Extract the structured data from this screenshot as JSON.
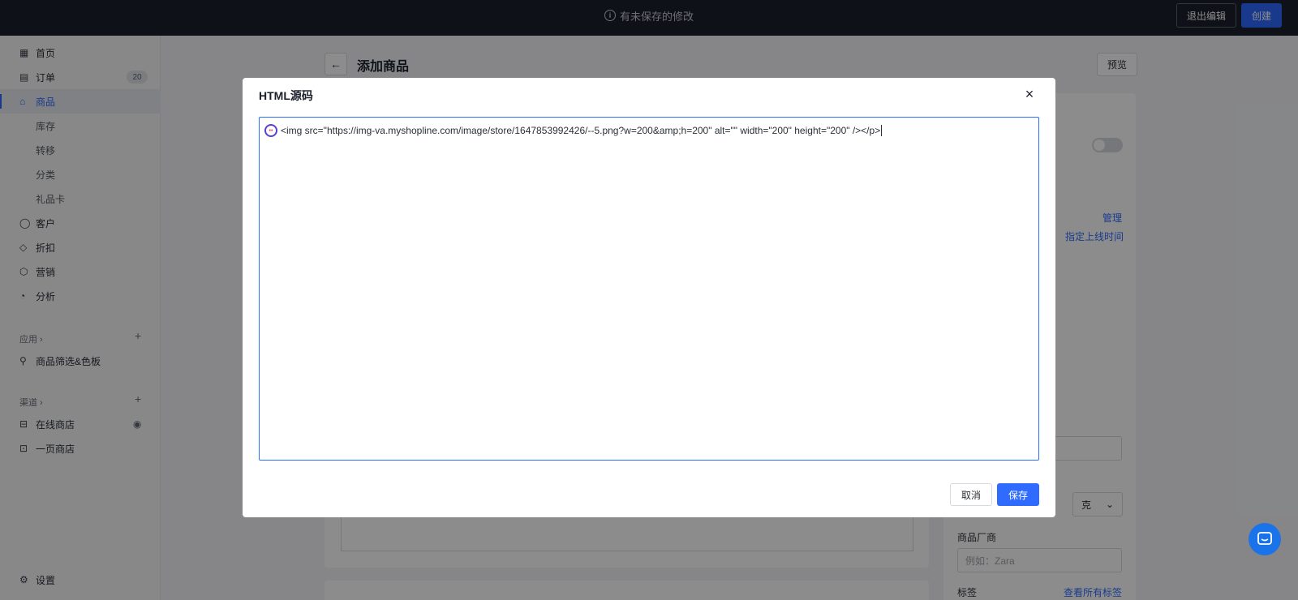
{
  "topbar": {
    "unsaved_text": "有未保存的修改",
    "exit_label": "退出编辑",
    "create_label": "创建"
  },
  "sidebar": {
    "items": [
      {
        "label": "首页",
        "icon": "home-icon"
      },
      {
        "label": "订单",
        "icon": "order-icon",
        "badge": "20"
      },
      {
        "label": "商品",
        "icon": "bag-icon"
      },
      {
        "label": "库存"
      },
      {
        "label": "转移"
      },
      {
        "label": "分类"
      },
      {
        "label": "礼品卡"
      },
      {
        "label": "客户",
        "icon": "user-icon"
      },
      {
        "label": "折扣",
        "icon": "tag-icon"
      },
      {
        "label": "营销",
        "icon": "cube-icon"
      },
      {
        "label": "分析",
        "icon": "pie-icon"
      }
    ],
    "apps_header": "应用",
    "apps": [
      {
        "label": "商品筛选&色板"
      }
    ],
    "channels_header": "渠道",
    "channels": [
      {
        "label": "在线商店"
      },
      {
        "label": "一页商店"
      }
    ],
    "settings_label": "设置"
  },
  "page": {
    "title": "添加商品",
    "preview_label": "预览",
    "manage_link": "管理",
    "schedule_link": "指定上线时间",
    "unit": "克",
    "vendor_label": "商品厂商",
    "vendor_placeholder": "例如：Zara",
    "tags_label": "标签",
    "view_tags_link": "查看所有标签"
  },
  "modal": {
    "title": "HTML源码",
    "close": "×",
    "code": "<img src=\"https://img-va.myshopline.com/image/store/1647853992426/--5.png?w=200&amp;h=200\" alt=\"\" width=\"200\" height=\"200\" /></p>",
    "cancel_label": "取消",
    "save_label": "保存"
  }
}
